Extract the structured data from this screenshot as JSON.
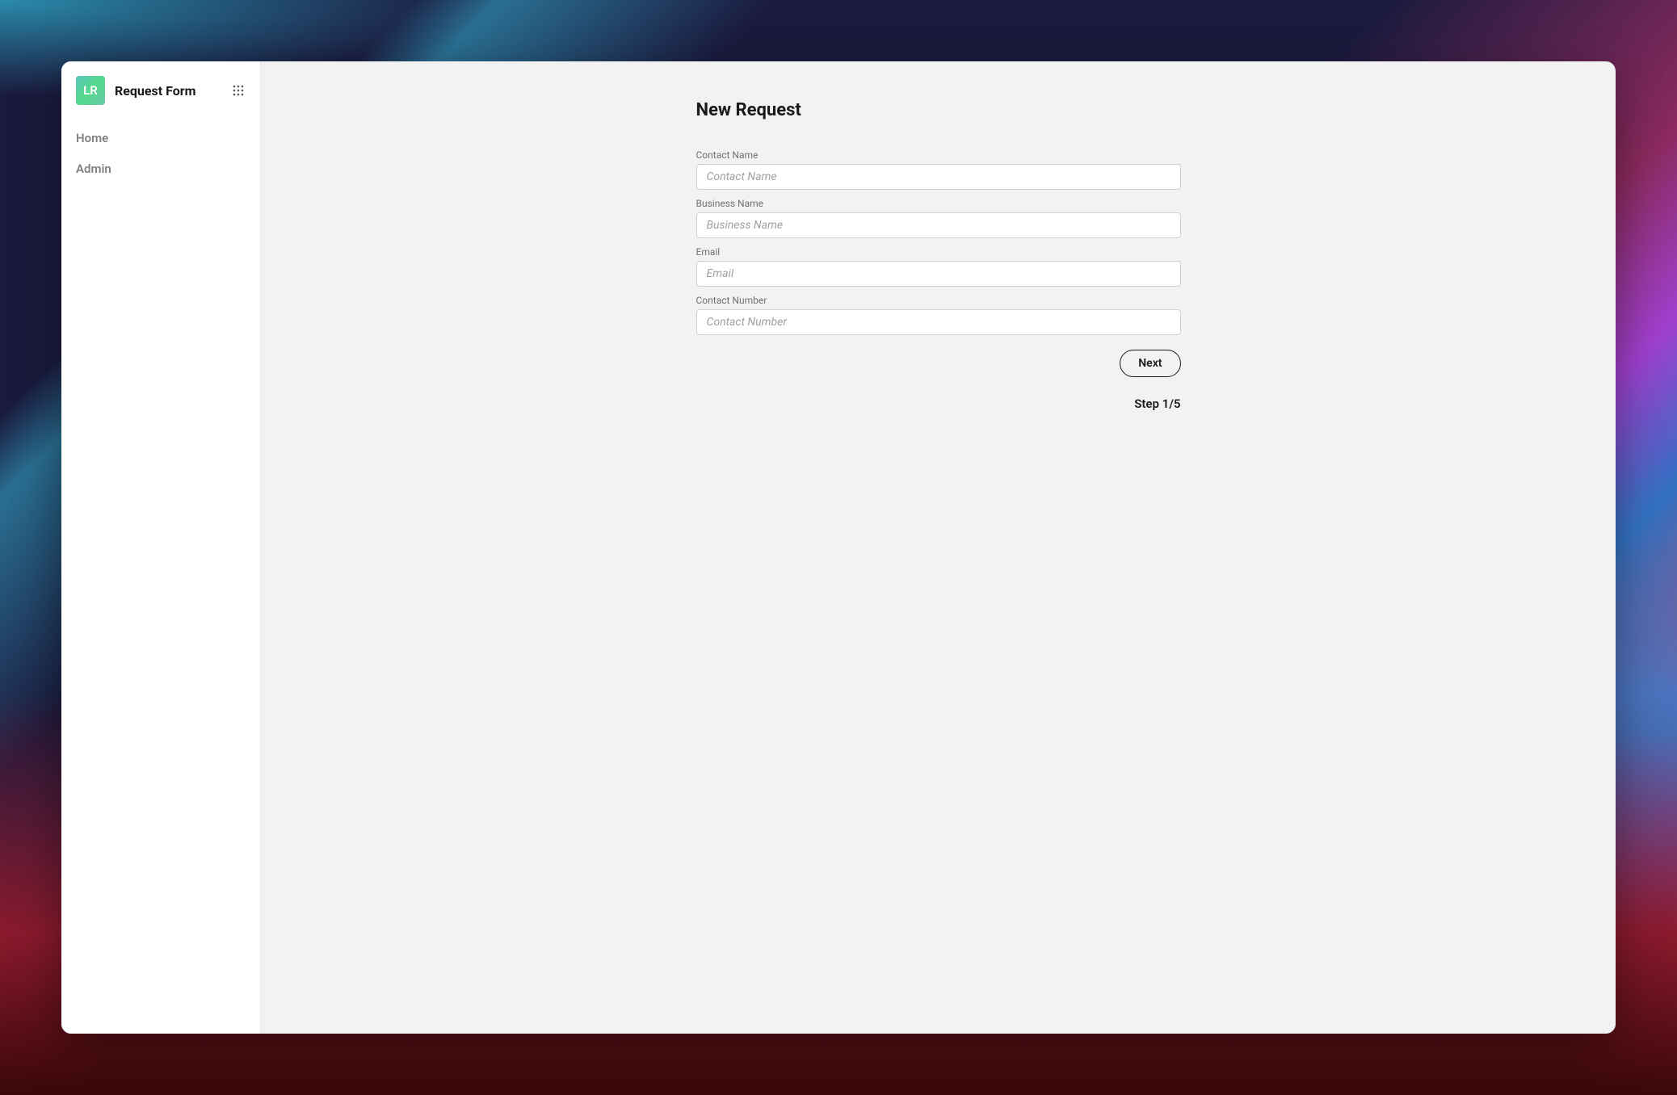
{
  "sidebar": {
    "logo_text": "LR",
    "app_title": "Request Form",
    "nav_items": [
      {
        "label": "Home"
      },
      {
        "label": "Admin"
      }
    ]
  },
  "main": {
    "title": "New Request",
    "fields": [
      {
        "label": "Contact Name",
        "placeholder": "Contact Name",
        "value": ""
      },
      {
        "label": "Business Name",
        "placeholder": "Business Name",
        "value": ""
      },
      {
        "label": "Email",
        "placeholder": "Email",
        "value": ""
      },
      {
        "label": "Contact Number",
        "placeholder": "Contact Number",
        "value": ""
      }
    ],
    "next_button_label": "Next",
    "step_indicator": "Step 1/5"
  }
}
